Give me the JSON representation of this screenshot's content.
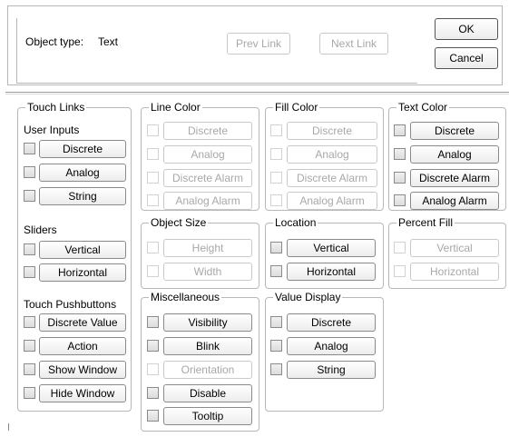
{
  "header": {
    "object_type_label": "Object type:",
    "object_type_value": "Text",
    "prev_link": "Prev Link",
    "next_link": "Next Link",
    "ok": "OK",
    "cancel": "Cancel"
  },
  "touch_links": {
    "title": "Touch Links",
    "user_inputs": "User Inputs",
    "discrete": "Discrete",
    "analog": "Analog",
    "string": "String",
    "sliders": "Sliders",
    "vertical": "Vertical",
    "horizontal": "Horizontal",
    "pushbuttons": "Touch Pushbuttons",
    "discrete_value": "Discrete Value",
    "action": "Action",
    "show_window": "Show Window",
    "hide_window": "Hide Window"
  },
  "line_color": {
    "title": "Line Color",
    "discrete": "Discrete",
    "analog": "Analog",
    "discrete_alarm": "Discrete Alarm",
    "analog_alarm": "Analog Alarm"
  },
  "fill_color": {
    "title": "Fill Color",
    "discrete": "Discrete",
    "analog": "Analog",
    "discrete_alarm": "Discrete Alarm",
    "analog_alarm": "Analog Alarm"
  },
  "text_color": {
    "title": "Text Color",
    "discrete": "Discrete",
    "analog": "Analog",
    "discrete_alarm": "Discrete Alarm",
    "analog_alarm": "Analog Alarm"
  },
  "object_size": {
    "title": "Object Size",
    "height": "Height",
    "width": "Width"
  },
  "location": {
    "title": "Location",
    "vertical": "Vertical",
    "horizontal": "Horizontal"
  },
  "percent_fill": {
    "title": "Percent Fill",
    "vertical": "Vertical",
    "horizontal": "Horizontal"
  },
  "miscellaneous": {
    "title": "Miscellaneous",
    "visibility": "Visibility",
    "blink": "Blink",
    "orientation": "Orientation",
    "disable": "Disable",
    "tooltip": "Tooltip"
  },
  "value_display": {
    "title": "Value Display",
    "discrete": "Discrete",
    "analog": "Analog",
    "string": "String"
  }
}
